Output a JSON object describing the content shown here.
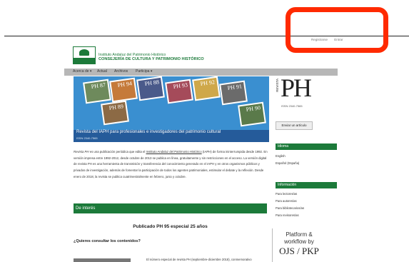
{
  "top": {
    "register": "Registrarse",
    "login": "Entrar"
  },
  "header": {
    "logo_label": "Junta de Andalucía",
    "org_line1": "Instituto Andaluz del Patrimonio Histórico",
    "org_line2": "CONSEJERÍA DE CULTURA Y PATRIMONIO HISTÓRICO"
  },
  "nav": {
    "items": [
      "Acerca de ▾",
      "Actual",
      "Archivos",
      "Participa ▾"
    ]
  },
  "hero": {
    "title": "Revista del IAPH para profesionales e investigadores del patrimonio cultural",
    "issn": "ISSN 2340-7565",
    "tiles": [
      "PH 87",
      "PH 94",
      "PH 88",
      "PH 93",
      "PH 92",
      "PH 91",
      "PH 89",
      "PH 90"
    ]
  },
  "brand": {
    "vertical": "REVISTA",
    "name": "PH",
    "issn": "ISSN 2340-7565"
  },
  "sidebar": {
    "send_button": "Enviar un artículo",
    "language_heading": "Idioma",
    "languages": [
      "English",
      "Español (España)"
    ],
    "info_heading": "Información",
    "info_links": [
      "Para lectores/as",
      "Para autores/as",
      "Para bibliotecarios/as",
      "Para revisores/as"
    ],
    "pkp_line1": "Platform &",
    "pkp_line2": "workflow by",
    "pkp_line3": "OJS / PKP"
  },
  "main": {
    "intro_em": "Revista PH",
    "intro_1": " es una publicación periódica que edita el ",
    "intro_link": "Instituto Andaluz del Patrimonio Histórico",
    "intro_2": " (IAPH) de forma ininterrumpida desde 1992. En versión impresa entre 1992-2012, desde octubre de 2013 se publica en línea, gratuitamente y sin restricciones en el acceso. La versión digital de revista PH es una herramienta de transmisión y transferencia del conocimiento generado en el IAPH y en otros organismos públicos y privados de investigación, además de fomentar la participación de todos los agentes patrimoniales, estimular el debate y la reflexión. Desde enero de 2018, la revista se publica cuatrimestralmente en febrero, junio y octubre.",
    "interest_heading": "De interés",
    "pub_title": "Publicado PH 95 especial 25 años",
    "question": "¿Quieres consultar los contenidos?",
    "excerpt": "El número especial de revista PH (septiembre-diciembre 2018), conmemorativo"
  },
  "colors": {
    "brand_green": "#1c7a3a",
    "annotation_red": "#ff2a00",
    "hero_blue": "#3a8fd0"
  }
}
